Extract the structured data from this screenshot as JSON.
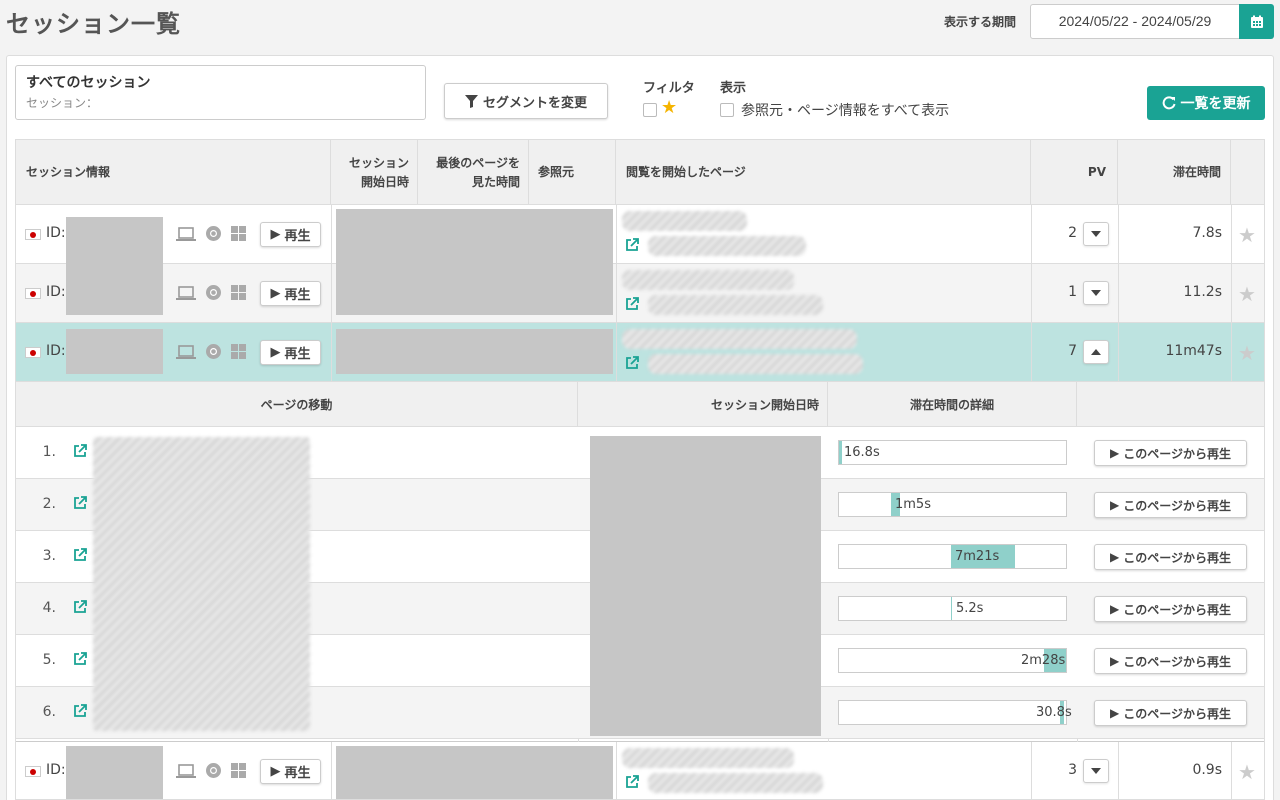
{
  "header": {
    "title": "セッション一覧",
    "period_label": "表示する期間",
    "date_range": "2024/05/22 - 2024/05/29"
  },
  "segment": {
    "title": "すべてのセッション",
    "subtitle": "セッション："
  },
  "toolbar": {
    "segment_button": "セグメントを変更",
    "filter_label": "フィルタ",
    "display_label": "表示",
    "display_option": "参照元・ページ情報をすべて表示",
    "refresh_button": "一覧を更新"
  },
  "columns": {
    "session_info": "セッション情報",
    "session_start_1": "セッション",
    "session_start_2": "開始日時",
    "last_page_1": "最後のページを",
    "last_page_2": "見た時間",
    "referrer": "参照元",
    "landing_page": "閲覧を開始したページ",
    "pv": "PV",
    "stay_time": "滞在時間"
  },
  "sessions": [
    {
      "id_label": "ID:",
      "play": "再生",
      "pv": "2",
      "stay": "7.8s"
    },
    {
      "id_label": "ID:",
      "play": "再生",
      "pv": "1",
      "stay": "11.2s"
    },
    {
      "id_label": "ID:",
      "play": "再生",
      "pv": "7",
      "stay": "11m47s"
    },
    {
      "id_label": "ID:",
      "play": "再生",
      "pv": "3",
      "stay": "0.9s"
    }
  ],
  "detail": {
    "col_page_move": "ページの移動",
    "col_start": "セッション開始日時",
    "col_stay_detail": "滞在時間の詳細",
    "replay_label": "このページから再生",
    "pages": [
      {
        "num": "1.",
        "stay": "16.8s"
      },
      {
        "num": "2.",
        "stay": "1m5s"
      },
      {
        "num": "3.",
        "stay": "7m21s"
      },
      {
        "num": "4.",
        "stay": "5.2s"
      },
      {
        "num": "5.",
        "stay": "2m28s"
      },
      {
        "num": "6.",
        "stay": "30.8s"
      }
    ]
  },
  "colors": {
    "accent": "#1aa394",
    "highlight_row": "#bde3e0",
    "bar_fill": "#8fd0ca",
    "star_active": "#f5b400"
  }
}
